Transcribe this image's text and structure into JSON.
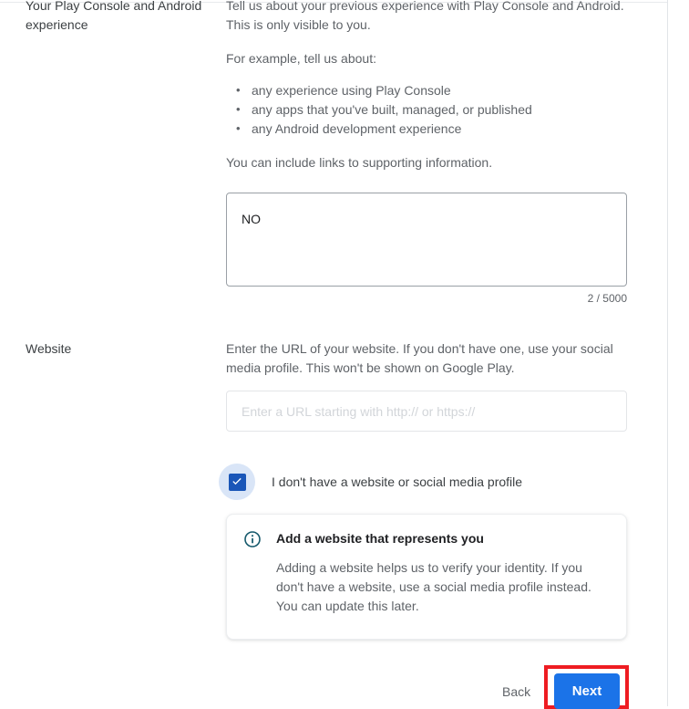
{
  "sections": {
    "experience": {
      "label": "Your Play Console and Android experience",
      "intro": "Tell us about your previous experience with Play Console and Android. This is only visible to you.",
      "example_lead": "For example, tell us about:",
      "examples": [
        "any experience using Play Console",
        "any apps that you've built, managed, or published",
        "any Android development experience"
      ],
      "links_note": "You can include links to supporting information.",
      "textarea_value": "NO",
      "textarea_placeholder": "",
      "char_count": "2 / 5000"
    },
    "website": {
      "label": "Website",
      "description": "Enter the URL of your website. If you don't have one, use your social media profile. This won't be shown on Google Play.",
      "input_value": "",
      "input_placeholder": "Enter a URL starting with http:// or https://",
      "checkbox_label": "I don't have a website or social media profile",
      "checkbox_checked": true,
      "info_card": {
        "icon": "info-circle-icon",
        "title": "Add a website that represents you",
        "body": "Adding a website helps us to verify your identity. If you don't have a website, use a social media profile instead. You can update this later."
      }
    }
  },
  "footer": {
    "back_label": "Back",
    "next_label": "Next"
  },
  "colors": {
    "primary_button": "#1b73e8",
    "checkbox_fill": "#1a56b8",
    "checkbox_halo": "#d9e5f7",
    "highlight_border": "#ee1c22",
    "info_icon": "#14586b",
    "body_text": "#5f6368",
    "label_text": "#3c4043"
  }
}
